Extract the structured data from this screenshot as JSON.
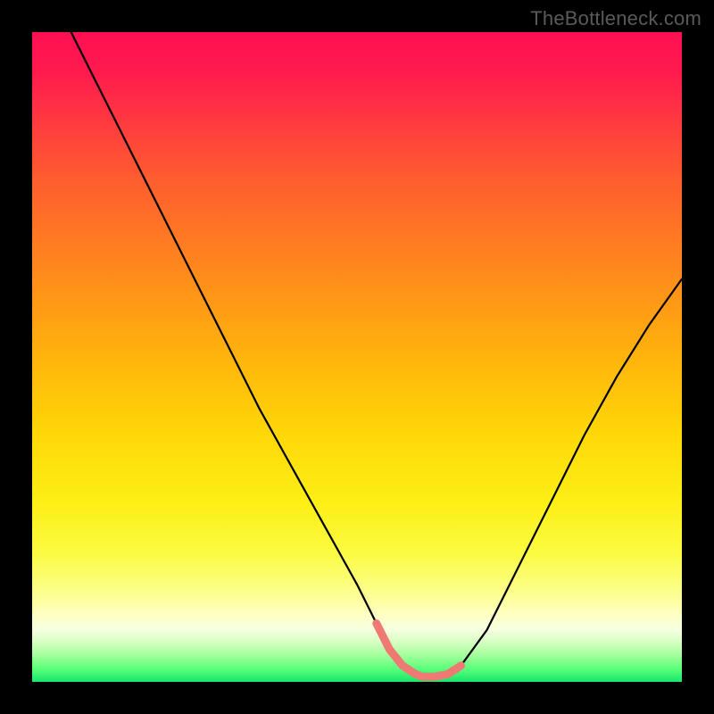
{
  "watermark": "TheBottleneck.com",
  "chart_data": {
    "type": "line",
    "title": "",
    "xlabel": "",
    "ylabel": "",
    "xlim": [
      0,
      100
    ],
    "ylim": [
      0,
      100
    ],
    "grid": false,
    "legend": false,
    "series": [
      {
        "name": "curve",
        "color": "#000000",
        "x": [
          6,
          10,
          15,
          20,
          25,
          30,
          35,
          40,
          45,
          50,
          53,
          55,
          57,
          59,
          60,
          62,
          64,
          66,
          70,
          75,
          80,
          85,
          90,
          95,
          100
        ],
        "y": [
          100,
          92,
          82,
          72,
          62,
          52,
          42,
          33,
          24,
          15,
          9,
          5,
          2.5,
          1.2,
          0.8,
          0.8,
          1.2,
          2.5,
          8,
          18,
          28,
          38,
          47,
          55,
          62
        ]
      },
      {
        "name": "highlight",
        "color": "#ef7a74",
        "x": [
          53,
          55,
          57,
          59,
          60,
          62,
          64,
          66
        ],
        "y": [
          9,
          5,
          2.5,
          1.2,
          0.8,
          0.8,
          1.2,
          2.5
        ]
      }
    ]
  }
}
